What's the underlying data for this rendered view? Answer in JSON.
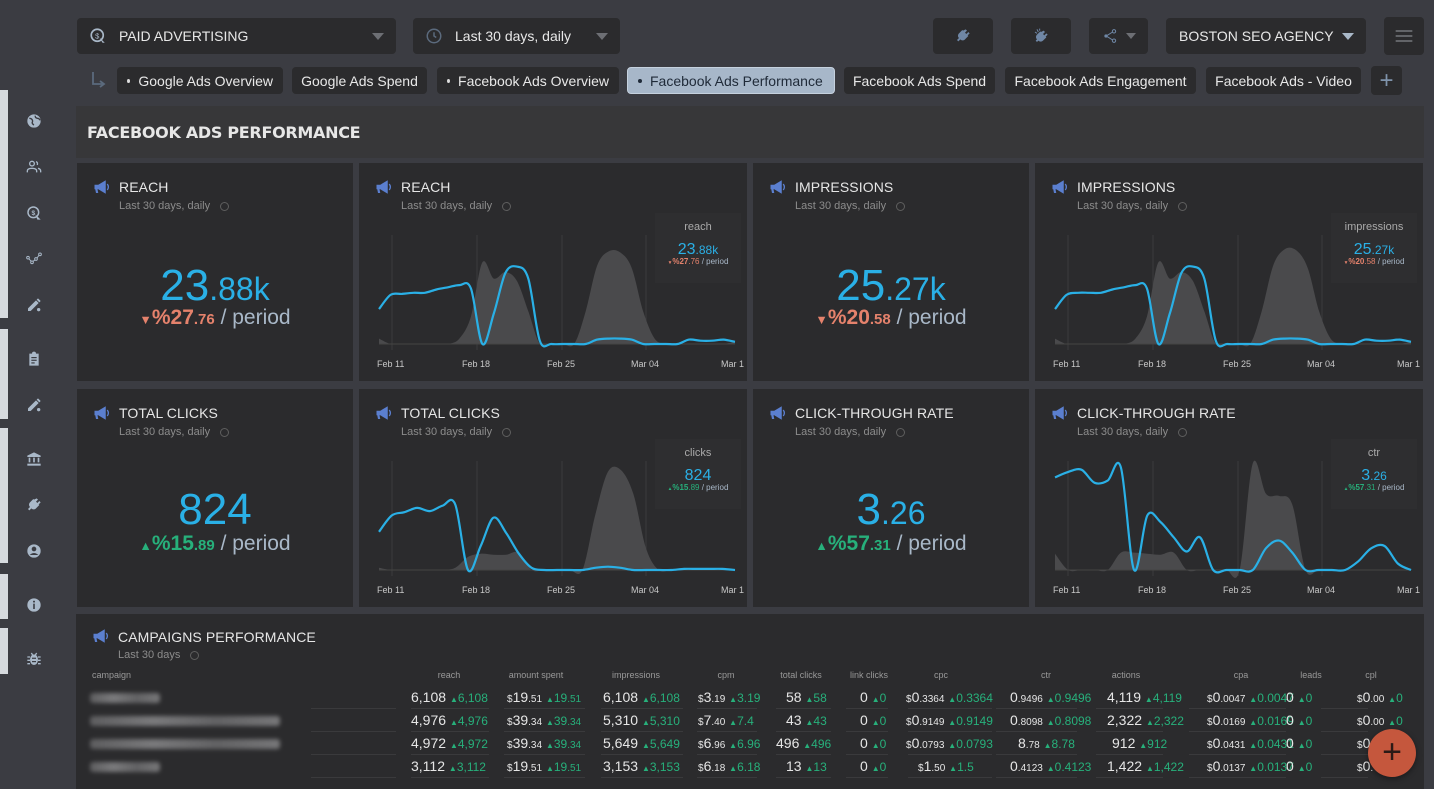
{
  "topbar": {
    "dashboard_select": {
      "value": "PAID ADVERTISING",
      "icon": "dollar-target-icon"
    },
    "date_select": {
      "value": "Last 30 days, daily",
      "icon": "clock-icon"
    },
    "buttons": [
      {
        "name": "plug-button",
        "icon": "plug-icon"
      },
      {
        "name": "plug-off-button",
        "icon": "plug-off-icon"
      },
      {
        "name": "share-button",
        "icon": "share-icon"
      }
    ],
    "client_select": {
      "value": "BOSTON SEO AGENCY"
    },
    "menu_icon": "hamburger-icon"
  },
  "tabs": [
    {
      "label": "Google Ads Overview",
      "dot": true,
      "active": false
    },
    {
      "label": "Google Ads Spend",
      "dot": false,
      "active": false
    },
    {
      "label": "Facebook Ads Overview",
      "dot": true,
      "active": false
    },
    {
      "label": "Facebook Ads Performance",
      "dot": true,
      "active": true
    },
    {
      "label": "Facebook Ads Spend",
      "dot": false,
      "active": false
    },
    {
      "label": "Facebook Ads Engagement",
      "dot": false,
      "active": false
    },
    {
      "label": "Facebook Ads - Video",
      "dot": false,
      "active": false
    }
  ],
  "tab_add_label": "+",
  "sidebar": {
    "icons": [
      "globe-icon",
      "users-icon",
      "dollar-target-icon",
      "trend-line-icon",
      "edit-pencil-icon",
      "clipboard-icon",
      "edit-pencil-icon",
      "bank-icon",
      "plug-icon",
      "account-circle-icon",
      "info-icon",
      "bug-icon"
    ]
  },
  "section": {
    "title": "FACEBOOK ADS PERFORMANCE"
  },
  "widgets": {
    "reach_kpi": {
      "title": "REACH",
      "subtitle": "Last 30 days, daily",
      "value_int": "23",
      "value_dec": ".88k",
      "direction": "down",
      "change_int": "%27",
      "change_dec": ".76",
      "period": " / period"
    },
    "reach_chart": {
      "title": "REACH",
      "subtitle": "Last 30 days, daily",
      "legend_title": "reach",
      "value_int": "23",
      "value_dec": ".88k",
      "direction": "down",
      "change_int": "%27",
      "change_dec": ".76",
      "period": " / period"
    },
    "impressions_kpi": {
      "title": "IMPRESSIONS",
      "subtitle": "Last 30 days, daily",
      "value_int": "25",
      "value_dec": ".27k",
      "direction": "down",
      "change_int": "%20",
      "change_dec": ".58",
      "period": " / period"
    },
    "impressions_chart": {
      "title": "IMPRESSIONS",
      "subtitle": "Last 30 days, daily",
      "legend_title": "impressions",
      "value_int": "25",
      "value_dec": ".27k",
      "direction": "down",
      "change_int": "%20",
      "change_dec": ".58",
      "period": " / period"
    },
    "clicks_kpi": {
      "title": "TOTAL CLICKS",
      "subtitle": "Last 30 days, daily",
      "value_int": "824",
      "value_dec": "",
      "direction": "up",
      "change_int": "%15",
      "change_dec": ".89",
      "period": " / period"
    },
    "clicks_chart": {
      "title": "TOTAL CLICKS",
      "subtitle": "Last 30 days, daily",
      "legend_title": "clicks",
      "value_int": "824",
      "value_dec": "",
      "direction": "up",
      "change_int": "%15",
      "change_dec": ".89",
      "period": " / period"
    },
    "ctr_kpi": {
      "title": "CLICK-THROUGH RATE",
      "subtitle": "Last 30 days, daily",
      "value_int": "3",
      "value_dec": ".26",
      "direction": "up",
      "change_int": "%57",
      "change_dec": ".31",
      "period": " / period"
    },
    "ctr_chart": {
      "title": "CLICK-THROUGH RATE",
      "subtitle": "Last 30 days, daily",
      "legend_title": "ctr",
      "value_int": "3",
      "value_dec": ".26",
      "direction": "up",
      "change_int": "%57",
      "change_dec": ".31",
      "period": " / period"
    }
  },
  "chart_data": [
    {
      "type": "area",
      "title": "REACH",
      "x_ticks": [
        "Feb 11",
        "Feb 18",
        "Feb 25",
        "Mar 04",
        "Mar 1"
      ],
      "series": [
        {
          "name": "current",
          "values": [
            0.32,
            0.45,
            0.46,
            0.47,
            0.47,
            0.5,
            0.52,
            0.54,
            0.51,
            0.0,
            0.28,
            0.65,
            0.71,
            0.6,
            0.03,
            0.0,
            0.0,
            0.0,
            0.0,
            0.04,
            0.05,
            0.05,
            0.04,
            0.0,
            0.0,
            0.0,
            0.0,
            0.04,
            0.03,
            0.03,
            0.04,
            0.02
          ]
        },
        {
          "name": "previous",
          "values": [
            0.05,
            0.0,
            0.0,
            0.0,
            0.0,
            0.0,
            0.0,
            0.05,
            0.25,
            0.75,
            0.6,
            0.66,
            0.58,
            0.3,
            0.0,
            0.0,
            0.0,
            0.0,
            0.3,
            0.72,
            0.85,
            0.84,
            0.7,
            0.3,
            0.05,
            0.0,
            0.0,
            0.0,
            0.0,
            0.0,
            0.0,
            0.02
          ]
        }
      ]
    },
    {
      "type": "area",
      "title": "IMPRESSIONS",
      "x_ticks": [
        "Feb 11",
        "Feb 18",
        "Feb 25",
        "Mar 04",
        "Mar 1"
      ],
      "series": [
        {
          "name": "current",
          "values": [
            0.32,
            0.45,
            0.47,
            0.47,
            0.47,
            0.5,
            0.52,
            0.54,
            0.51,
            0.0,
            0.28,
            0.65,
            0.71,
            0.6,
            0.03,
            0.0,
            0.0,
            0.0,
            0.0,
            0.04,
            0.05,
            0.05,
            0.04,
            0.0,
            0.0,
            0.0,
            0.0,
            0.04,
            0.03,
            0.03,
            0.04,
            0.02
          ]
        },
        {
          "name": "previous",
          "values": [
            0.05,
            0.0,
            0.0,
            0.0,
            0.0,
            0.0,
            0.0,
            0.05,
            0.25,
            0.75,
            0.6,
            0.66,
            0.58,
            0.3,
            0.0,
            0.0,
            0.0,
            0.0,
            0.3,
            0.72,
            0.87,
            0.86,
            0.7,
            0.3,
            0.05,
            0.0,
            0.0,
            0.0,
            0.0,
            0.0,
            0.0,
            0.02
          ]
        }
      ]
    },
    {
      "type": "area",
      "title": "TOTAL CLICKS",
      "x_ticks": [
        "Feb 11",
        "Feb 18",
        "Feb 25",
        "Mar 04",
        "Mar 1"
      ],
      "series": [
        {
          "name": "current",
          "values": [
            0.35,
            0.5,
            0.53,
            0.57,
            0.54,
            0.59,
            0.6,
            0.0,
            0.22,
            0.48,
            0.34,
            0.15,
            0.02,
            0.0,
            0.0,
            0.0,
            0.0,
            0.02,
            0.03,
            0.02,
            0.0,
            0.0,
            0.0,
            0.0,
            0.01,
            0.01,
            0.01,
            0.01,
            0.0
          ]
        },
        {
          "name": "previous",
          "values": [
            0.02,
            0.0,
            0.0,
            0.0,
            0.0,
            0.0,
            0.02,
            0.12,
            0.15,
            0.14,
            0.14,
            0.16,
            0.0,
            0.0,
            0.0,
            0.0,
            0.0,
            0.5,
            0.9,
            0.92,
            0.7,
            0.2,
            0.0,
            0.0,
            0.0,
            0.0,
            0.0,
            0.0,
            0.0
          ]
        }
      ]
    },
    {
      "type": "area",
      "title": "CLICK-THROUGH RATE",
      "x_ticks": [
        "Feb 11",
        "Feb 18",
        "Feb 25",
        "Mar 04",
        "Mar 1"
      ],
      "series": [
        {
          "name": "current",
          "values": [
            0.85,
            0.9,
            0.92,
            0.8,
            0.82,
            0.94,
            0.0,
            0.5,
            0.44,
            0.3,
            0.17,
            0.3,
            0.0,
            0.0,
            0.0,
            0.0,
            0.2,
            0.27,
            0.16,
            0.0,
            0.0,
            0.0,
            0.0,
            0.08,
            0.2,
            0.22,
            0.06,
            0.0
          ]
        },
        {
          "name": "previous",
          "values": [
            0.15,
            0.0,
            0.0,
            0.0,
            0.0,
            0.16,
            0.16,
            0.15,
            0.14,
            0.16,
            0.0,
            0.0,
            0.0,
            0.0,
            0.0,
            0.98,
            0.7,
            0.68,
            0.6,
            0.0,
            0.0,
            0.0,
            0.0,
            0.0,
            0.0,
            0.0,
            0.0,
            0.0
          ]
        }
      ]
    }
  ],
  "campaigns": {
    "title": "CAMPAIGNS PERFORMANCE",
    "subtitle": "Last 30 days",
    "columns": [
      "campaign",
      "reach",
      "amount spent",
      "impressions",
      "cpm",
      "total clicks",
      "link clicks",
      "cpc",
      "ctr",
      "actions",
      "cpa",
      "leads",
      "cpl"
    ],
    "rows": [
      {
        "campaign": "[redacted]",
        "reach": [
          "6,108",
          "",
          "6,108",
          ""
        ],
        "amount_spent": [
          "$",
          "19",
          ".51",
          "19",
          ".51"
        ],
        "impressions": [
          "6,108",
          "6,108"
        ],
        "cpm": [
          "$",
          "3",
          ".19",
          "3.19"
        ],
        "total_clicks": [
          "58",
          "58"
        ],
        "link_clicks": [
          "0",
          "0"
        ],
        "cpc": [
          "$",
          "0",
          ".3364",
          "0.3364"
        ],
        "ctr": [
          "0",
          ".9496",
          "0.9496"
        ],
        "actions": [
          "4,119",
          "4,119"
        ],
        "cpa": [
          "$",
          "0",
          ".0047",
          "0.0047"
        ],
        "leads": [
          "0",
          "0"
        ],
        "cpl": [
          "$",
          "0",
          ".00",
          "0"
        ]
      },
      {
        "campaign": "[redacted]",
        "reach": [
          "4,976",
          "",
          "4,976",
          ""
        ],
        "amount_spent": [
          "$",
          "39",
          ".34",
          "39",
          ".34"
        ],
        "impressions": [
          "5,310",
          "5,310"
        ],
        "cpm": [
          "$",
          "7",
          ".40",
          "7.4"
        ],
        "total_clicks": [
          "43",
          "43"
        ],
        "link_clicks": [
          "0",
          "0"
        ],
        "cpc": [
          "$",
          "0",
          ".9149",
          "0.9149"
        ],
        "ctr": [
          "0",
          ".8098",
          "0.8098"
        ],
        "actions": [
          "2,322",
          "2,322"
        ],
        "cpa": [
          "$",
          "0",
          ".0169",
          "0.0169"
        ],
        "leads": [
          "0",
          "0"
        ],
        "cpl": [
          "$",
          "0",
          ".00",
          "0"
        ]
      },
      {
        "campaign": "[redacted]",
        "reach": [
          "4,972",
          "",
          "4,972",
          ""
        ],
        "amount_spent": [
          "$",
          "39",
          ".34",
          "39",
          ".34"
        ],
        "impressions": [
          "5,649",
          "5,649"
        ],
        "cpm": [
          "$",
          "6",
          ".96",
          "6.96"
        ],
        "total_clicks": [
          "496",
          "496"
        ],
        "link_clicks": [
          "0",
          "0"
        ],
        "cpc": [
          "$",
          "0",
          ".0793",
          "0.0793"
        ],
        "ctr": [
          "8",
          ".78",
          "8.78"
        ],
        "actions": [
          "912",
          "912"
        ],
        "cpa": [
          "$",
          "0",
          ".0431",
          "0.0431"
        ],
        "leads": [
          "0",
          "0"
        ],
        "cpl": [
          "$",
          "0",
          ".",
          ""
        ]
      },
      {
        "campaign": "[redacted]",
        "reach": [
          "3,112",
          "",
          "3,112",
          ""
        ],
        "amount_spent": [
          "$",
          "19",
          ".51",
          "19",
          ".51"
        ],
        "impressions": [
          "3,153",
          "3,153"
        ],
        "cpm": [
          "$",
          "6",
          ".18",
          "6.18"
        ],
        "total_clicks": [
          "13",
          "13"
        ],
        "link_clicks": [
          "0",
          "0"
        ],
        "cpc": [
          "$",
          "1",
          ".50",
          "1.5"
        ],
        "ctr": [
          "0",
          ".4123",
          "0.4123"
        ],
        "actions": [
          "1,422",
          "1,422"
        ],
        "cpa": [
          "$",
          "0",
          ".0137",
          "0.0137"
        ],
        "leads": [
          "0",
          "0"
        ],
        "cpl": [
          "$",
          "0",
          ".",
          ""
        ]
      }
    ]
  },
  "up_arrow": "▲",
  "down_arrow": "▼",
  "fab_label": "+",
  "colors": {
    "accent_blue": "#2ab0e6",
    "positive": "#27b07b",
    "negative": "#e5826c",
    "icon_blue": "#5b7fcf",
    "fab": "#c5573d",
    "active_tab": "#a7b7c9"
  }
}
